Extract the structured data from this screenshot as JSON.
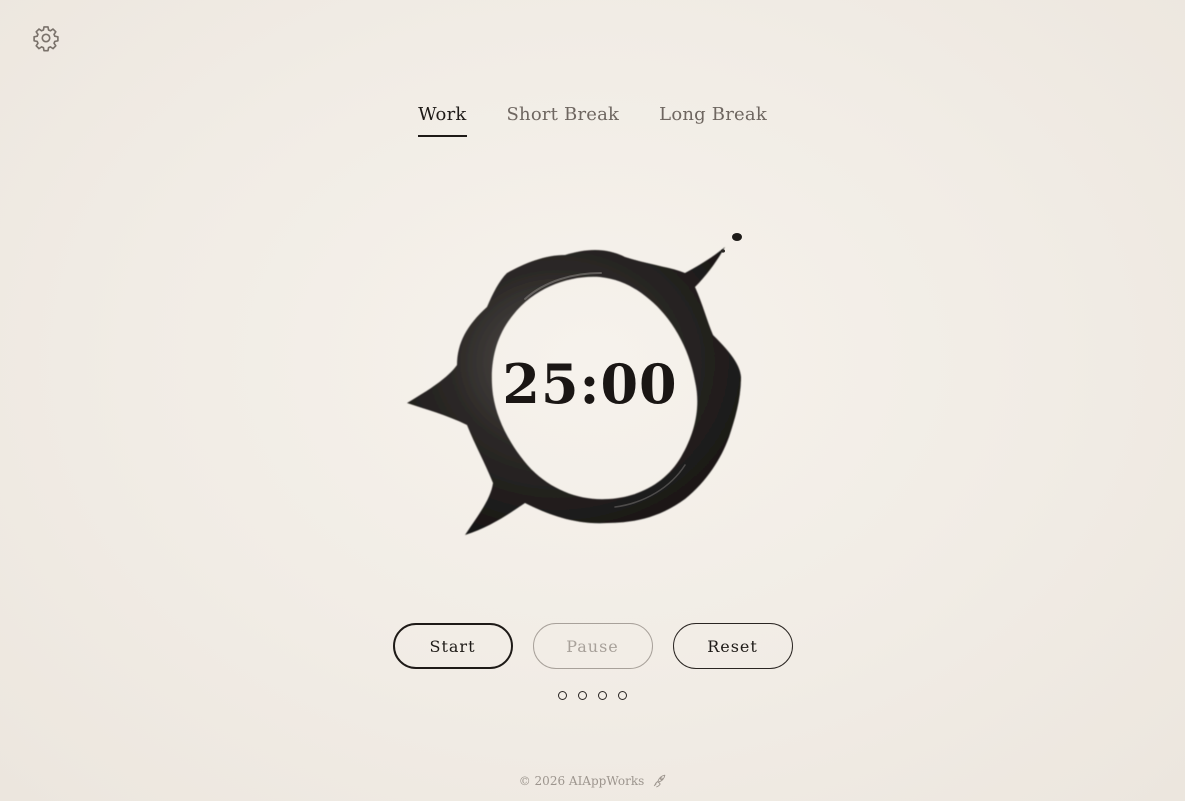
{
  "settings": {
    "icon": "gear-icon"
  },
  "tabs": [
    {
      "label": "Work",
      "active": true
    },
    {
      "label": "Short Break",
      "active": false
    },
    {
      "label": "Long Break",
      "active": false
    }
  ],
  "timer": {
    "display": "25:00"
  },
  "controls": {
    "start_label": "Start",
    "pause_label": "Pause",
    "reset_label": "Reset"
  },
  "session_dots": [
    false,
    false,
    false,
    false
  ],
  "footer": {
    "text": "© 2026 AIAppWorks",
    "icon": "rocket-icon"
  },
  "colors": {
    "ink": "#1e1a17",
    "background": "#f2ede6",
    "muted": "#a8a19a"
  }
}
